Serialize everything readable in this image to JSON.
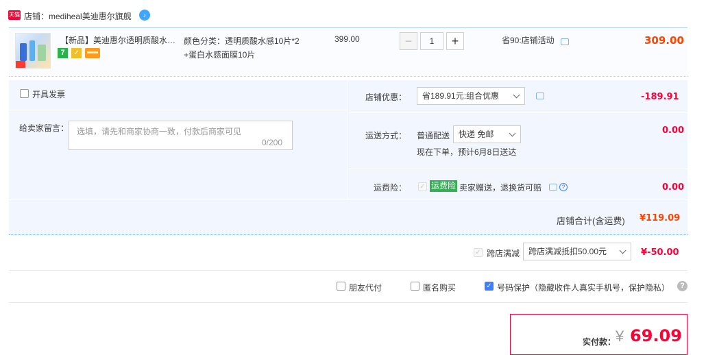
{
  "store": {
    "badge": "天猫",
    "name": "店铺：mediheal美迪惠尔旗舰",
    "chat_icon": "wangwang-icon"
  },
  "item": {
    "title": "【新品】美迪惠尔透明质酸水感补水保湿面膜",
    "spec_line1": "颜色分类：透明质酸水感10片*2",
    "spec_line2": "+蛋白水感面膜10片",
    "unit_price": "399.00",
    "qty_minus": "−",
    "quantity": "1",
    "qty_plus": "+",
    "promo": "省90:店铺活动",
    "subtotal": "309.00",
    "badge_7": "7",
    "badge_shield": "✓"
  },
  "invoice": {
    "label": "开具发票"
  },
  "message": {
    "label": "给卖家留言：",
    "placeholder": "选填，请先和商家协商一致，付款后商家可见",
    "count": "0/200"
  },
  "store_discount": {
    "label": "店铺优惠：",
    "selected": "省189.91元:组合优惠",
    "amount": "-189.91"
  },
  "shipping": {
    "label": "运送方式：",
    "method": "普通配送",
    "selected": "快递 免邮",
    "eta": "现在下单，预计6月8日送达",
    "amount": "0.00"
  },
  "freight_insurance": {
    "label": "运费险：",
    "tag": "运费险",
    "text": "卖家赠送，退换货可赔",
    "amount": "0.00"
  },
  "store_total": {
    "label": "店铺合计(含运费)",
    "amount": "¥119.09"
  },
  "cross_store": {
    "label": "跨店满减",
    "selected": "跨店满减抵扣50.00元",
    "amount": "¥-50.00"
  },
  "options": {
    "friend_pay": "朋友代付",
    "anonymous": "匿名购买",
    "number_protect": "号码保护（隐藏收件人真实手机号，保护隐私）",
    "help": "?"
  },
  "payment": {
    "label": "实付款：",
    "currency": "¥",
    "amount": "69.09"
  },
  "colors": {
    "accent": "#ff0036",
    "orange": "#ff4400",
    "panel": "#f2f7ff",
    "green": "#36ae54",
    "blue": "#3f7fff"
  }
}
